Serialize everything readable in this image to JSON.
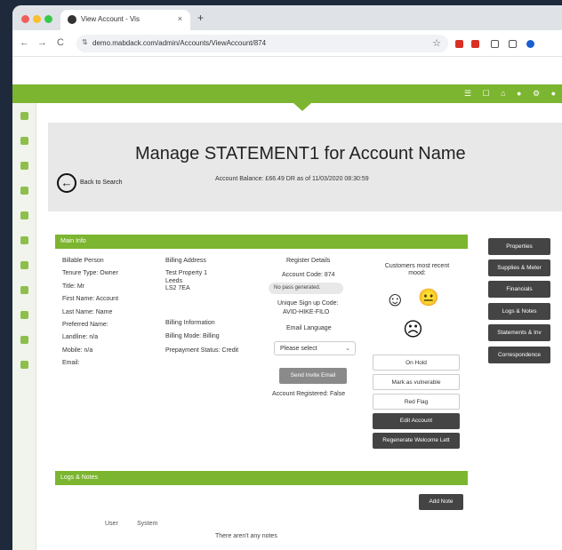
{
  "browser": {
    "tab_title": "View Account - Vis",
    "tab_close": "×",
    "new_tab": "+",
    "url": "demo.mabdack.com/admin/Accounts/ViewAccount/874",
    "nav_back": "←",
    "nav_forward": "→",
    "nav_reload": "C",
    "star": "☆",
    "traffic_colors": [
      "#f25f58",
      "#fbbe2e",
      "#39c94a"
    ]
  },
  "topbar": {
    "icons": "☰ ☐ ⌂ ● ⚙ ●",
    "accent": "#7cb530"
  },
  "header": {
    "title": "Manage STATEMENT1 for Account Name",
    "back_label": "Back to Search",
    "back_arrow": "←",
    "balance": "Account Balance: £66.49 DR as of 11/03/2020 08:30:59"
  },
  "main_info": {
    "heading": "Main Info",
    "col1": [
      "Billable Person",
      "Tenure Type: Owner",
      "Title: Mr",
      "First Name: Account",
      "Last Name: Name",
      "Preferred Name:",
      "Landline: n/a",
      "Mobile: n/a",
      "Email:"
    ],
    "col2_address_label": "Billing Address",
    "col2_address": [
      "Test Property 1",
      "Leeds",
      "LS2 7EA"
    ],
    "col2_billing_label": "Billing Information",
    "col2_billing": [
      "Billing Mode: Billing",
      "Prepayment Status: Credit"
    ],
    "col3": {
      "register_label": "Register Details",
      "account_code": "Account Code: 874",
      "passcode": "No pass generated.",
      "signup_label": "Unique Sign up Code:",
      "signup_code": "AVID-HIKE-FILO",
      "email_language": "Email Language",
      "select_placeholder": "Please select",
      "send_invite": "Send Invite Email",
      "registered": "Account Registered: False"
    },
    "mood": {
      "label": "Customers most recent mood:",
      "faces": [
        "☺",
        "😐",
        "☹"
      ]
    },
    "actions": {
      "on_hold": "On Hold",
      "vulnerable": "Mark as vulnerable",
      "red_flag": "Red Flag",
      "edit": "Edit Account",
      "regenerate": "Regenerate Welcome Lett"
    }
  },
  "right_nav": [
    "Properties",
    "Supplies & Meter",
    "Financials",
    "Logs & Notes",
    "Statements & Inv",
    "Correspondence"
  ],
  "logs": {
    "heading": "Logs & Notes",
    "add_note": "Add Note",
    "tabs": [
      "User",
      "System"
    ],
    "empty": "There aren't any notes"
  }
}
